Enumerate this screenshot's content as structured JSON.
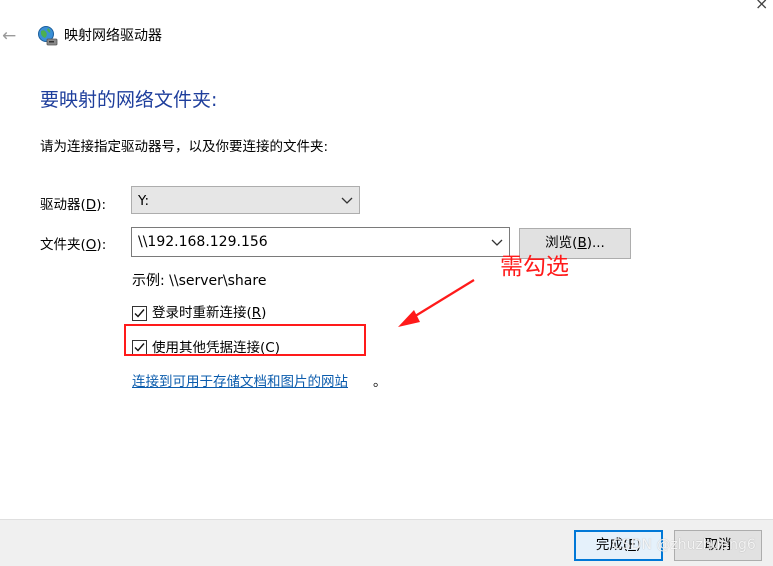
{
  "window": {
    "title": "映射网络驱动器"
  },
  "heading": "要映射的网络文件夹:",
  "instruction": "请为连接指定驱动器号，以及你要连接的文件夹:",
  "drive": {
    "label": "驱动器",
    "accel": "D",
    "label_suffix": "):",
    "selected": "Y:"
  },
  "folder": {
    "label": "文件夹",
    "accel": "O",
    "label_suffix": "):",
    "value": "\\\\192.168.129.156"
  },
  "browse": {
    "label": "浏览(",
    "accel": "B",
    "suffix": ")..."
  },
  "example": "示例: \\\\server\\share",
  "reconnect": {
    "checked": true,
    "label": "登录时重新连接(",
    "accel": "R",
    "suffix": ")"
  },
  "other_credentials": {
    "checked": true,
    "label": "使用其他凭据连接(C)"
  },
  "link": {
    "text": "连接到可用于存储文档和图片的网站",
    "trailing": "。"
  },
  "annotation": {
    "text": "需勾选",
    "color": "#ff1a1a"
  },
  "footer": {
    "finish_label": "完成(",
    "finish_accel": "F",
    "finish_suffix": ")",
    "cancel_label": "取消"
  },
  "watermark": "CSDN @zhuzhuang6",
  "colors": {
    "heading": "#1e3e9c",
    "link": "#0b5cad",
    "accent": "#0078d7"
  }
}
